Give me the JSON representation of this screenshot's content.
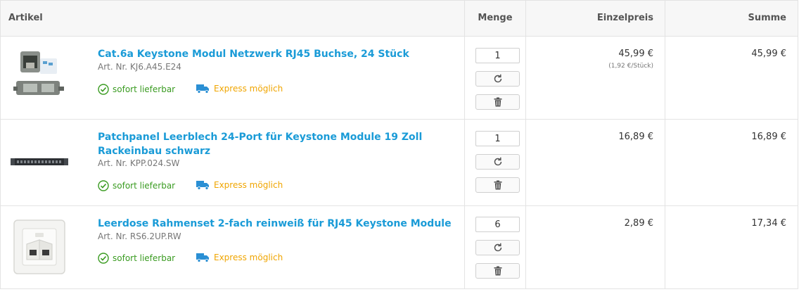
{
  "header": {
    "artikel": "Artikel",
    "menge": "Menge",
    "einzelpreis": "Einzelpreis",
    "summe": "Summe"
  },
  "items": [
    {
      "title": "Cat.6a Keystone Modul Netzwerk RJ45 Buchse, 24 Stück",
      "art_nr": "Art. Nr. KJ6.A45.E24",
      "availability": "sofort lieferbar",
      "express": "Express möglich",
      "quantity": "1",
      "unit_price": "45,99 €",
      "unit_note": "(1,92 €/Stück)",
      "sum": "45,99 €",
      "image": "keystone-module-image"
    },
    {
      "title": "Patchpanel Leerblech 24-Port für Keystone Module 19 Zoll Rackeinbau schwarz",
      "art_nr": "Art. Nr. KPP.024.SW",
      "availability": "sofort lieferbar",
      "express": "Express möglich",
      "quantity": "1",
      "unit_price": "16,89 €",
      "unit_note": "",
      "sum": "16,89 €",
      "image": "patch-panel-image"
    },
    {
      "title": "Leerdose Rahmenset 2-fach reinweiß für RJ45 Keystone Module",
      "art_nr": "Art. Nr. RS6.2UP.RW",
      "availability": "sofort lieferbar",
      "express": "Express möglich",
      "quantity": "6",
      "unit_price": "2,89 €",
      "unit_note": "",
      "sum": "17,34 €",
      "image": "wall-outlet-image"
    }
  ],
  "icons": {
    "refresh": "refresh-icon",
    "delete": "trash-icon",
    "available": "check-circle-icon",
    "express": "truck-icon"
  },
  "colors": {
    "link": "#1a9bd7",
    "available": "#3a9b21",
    "express": "#f0a500",
    "express_truck": "#2a8fd4"
  }
}
